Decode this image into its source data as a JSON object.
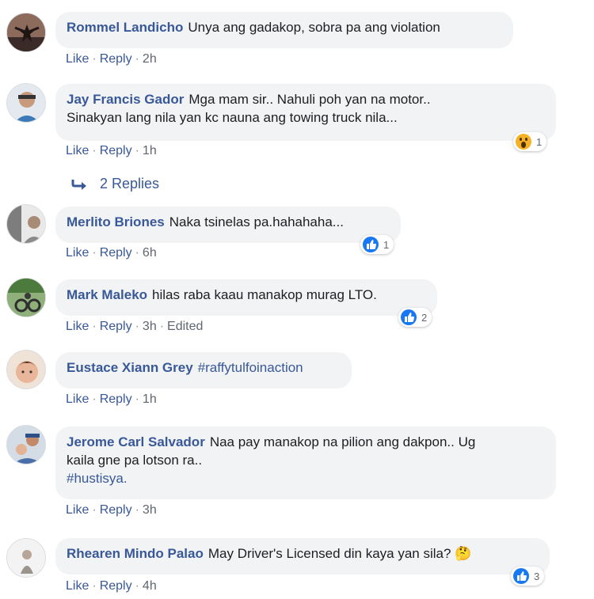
{
  "comments": [
    {
      "name": "Rommel Landicho",
      "text": "Unya ang gadakop, sobra pa ang violation",
      "time": "2h"
    },
    {
      "name": "Jay Francis Gador",
      "text_line1": "Mga mam sir.. Nahuli poh yan na motor..",
      "text_line2": "Sinakyan lang nila yan kc nauna ang towing truck nila...",
      "time": "1h",
      "reaction_count": "1",
      "reaction_icon": "wow-icon"
    },
    {
      "name": "Merlito Briones",
      "text": "Naka tsinelas pa.hahahaha...",
      "time": "6h",
      "reaction_count": "1",
      "reaction_icon": "like-icon"
    },
    {
      "name": "Mark Maleko",
      "text": "hilas raba kaau manakop murag LTO.",
      "time": "3h",
      "edited": "Edited",
      "reaction_count": "2",
      "reaction_icon": "like-icon"
    },
    {
      "name": "Eustace Xiann Grey",
      "hashtag": "#raffytulfoinaction",
      "time": "1h"
    },
    {
      "name": "Jerome Carl Salvador",
      "text_line1": "Naa pay manakop na pilion ang dakpon.. Ug",
      "text_line2": "kaila gne pa lotson ra..",
      "hashtag": "#hustisya.",
      "time": "3h"
    },
    {
      "name": "Rhearen Mindo Palao",
      "text": "May Driver's Licensed din kaya yan sila?",
      "emoji": "🤔",
      "time": "4h",
      "reaction_count": "3",
      "reaction_icon": "like-icon"
    }
  ],
  "actions": {
    "like": "Like",
    "reply": "Reply",
    "separator": "·"
  },
  "replies_label": "2 Replies",
  "colors": {
    "link": "#385898",
    "bubble": "#f2f3f5",
    "meta": "#606770",
    "like_blue": "#1877f2"
  }
}
